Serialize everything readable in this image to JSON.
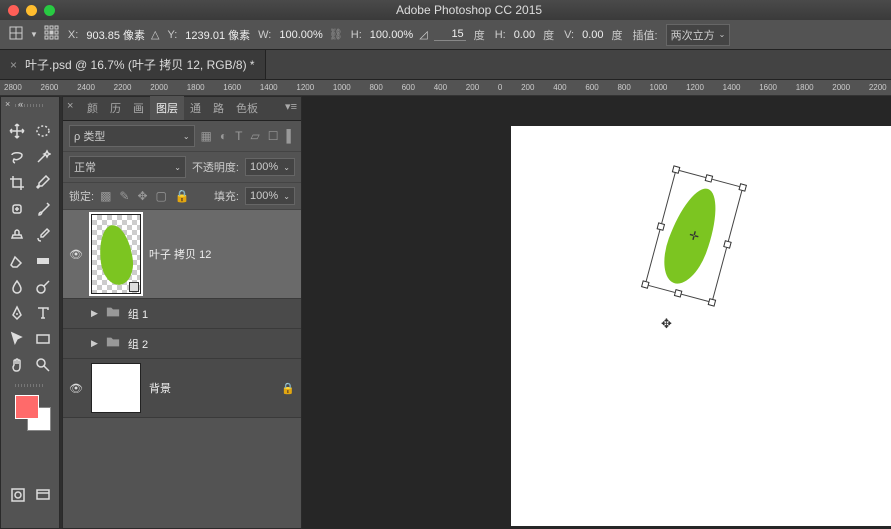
{
  "app": {
    "title": "Adobe Photoshop CC 2015"
  },
  "options": {
    "x_label": "X:",
    "x_value": "903.85 像素",
    "y_label": "Y:",
    "y_value": "1239.01 像素",
    "w_label": "W:",
    "w_value": "100.00%",
    "h_label": "H:",
    "h_value": "100.00%",
    "angle_value": "15",
    "degree": "度",
    "h_skew_label": "H:",
    "h_skew_value": "0.00",
    "v_skew_label": "V:",
    "v_skew_value": "0.00",
    "interp_label": "插值:",
    "interp_value": "两次立方"
  },
  "document": {
    "tab_title": "叶子.psd @ 16.7% (叶子 拷贝 12, RGB/8) *"
  },
  "ruler": {
    "ticks": [
      "2800",
      "2600",
      "2400",
      "2200",
      "2000",
      "1800",
      "1600",
      "1400",
      "1200",
      "1000",
      "800",
      "600",
      "400",
      "200",
      "0",
      "200",
      "400",
      "600",
      "800",
      "1000",
      "1200",
      "1400",
      "1600",
      "1800",
      "2000",
      "2200"
    ]
  },
  "panels": {
    "tabs": [
      "颜",
      "历",
      "画",
      "图层",
      "通",
      "路",
      "色板"
    ],
    "active_tab": "图层",
    "kind_label": "ρ 类型",
    "blend_mode": "正常",
    "opacity_label": "不透明度:",
    "opacity_value": "100%",
    "lock_label": "锁定:",
    "fill_label": "填充:",
    "fill_value": "100%"
  },
  "layers": {
    "items": [
      {
        "eye": true,
        "name": "叶子 拷贝 12",
        "type": "shape"
      },
      {
        "eye": false,
        "name": "组 1",
        "type": "group"
      },
      {
        "eye": false,
        "name": "组 2",
        "type": "group"
      },
      {
        "eye": true,
        "name": "背景",
        "type": "bg"
      }
    ]
  },
  "colors": {
    "fg": "#ff6a6a",
    "bg": "#ffffff",
    "leaf": "#7cc521"
  }
}
